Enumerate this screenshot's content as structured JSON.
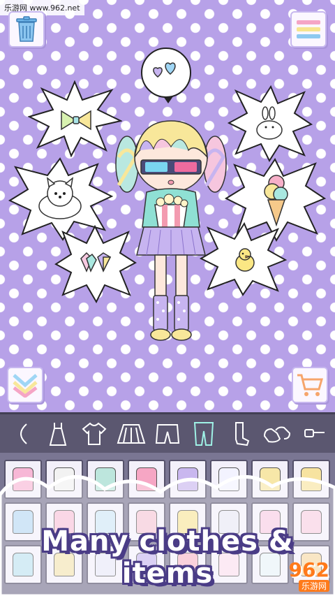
{
  "watermark": "乐游网 www.962.net",
  "stage": {
    "bubbles": [
      "bow",
      "puppy",
      "gems",
      "bunny",
      "ice-cream",
      "chick",
      "hearts"
    ]
  },
  "tabs": [
    {
      "name": "tab-partial",
      "icon": "partial-icon"
    },
    {
      "name": "tab-dress",
      "icon": "dress-icon"
    },
    {
      "name": "tab-shirt",
      "icon": "shirt-icon"
    },
    {
      "name": "tab-skirt",
      "icon": "skirt-icon"
    },
    {
      "name": "tab-shorts",
      "icon": "shorts-icon"
    },
    {
      "name": "tab-legwear",
      "icon": "legwear-icon",
      "active": true
    },
    {
      "name": "tab-socks",
      "icon": "socks-icon"
    },
    {
      "name": "tab-shoes",
      "icon": "shoes-icon"
    },
    {
      "name": "tab-more",
      "icon": "glasses-icon"
    }
  ],
  "items": [
    "#f7b7d6",
    "#f2f2f2",
    "#bde6dd",
    "#f6a6c4",
    "#c9b7ef",
    "#f3f3ff",
    "#f7e7a8",
    "#f7e3a0",
    "#b9d9f3",
    "#f7c2d9",
    "#cfe7f6",
    "#f4c6d6",
    "#f8e59b",
    "#e8e8f5",
    "#f7cde4",
    "#f7cfe2",
    "#bfe2f0",
    "#f3e4b3",
    "#e9e9f7",
    "#c8b9ee",
    "#f7b9c9",
    "#fadfef",
    "#e8f3f7",
    "#f6d9a7"
  ],
  "caption": "Many clothes & items",
  "logo": {
    "num": "962",
    "sub": "乐游网"
  },
  "colors": {
    "background": "#b7a1e8",
    "tabbar": "#5b5770",
    "grid": "#7a7693",
    "accent": "#9ff2e6"
  }
}
